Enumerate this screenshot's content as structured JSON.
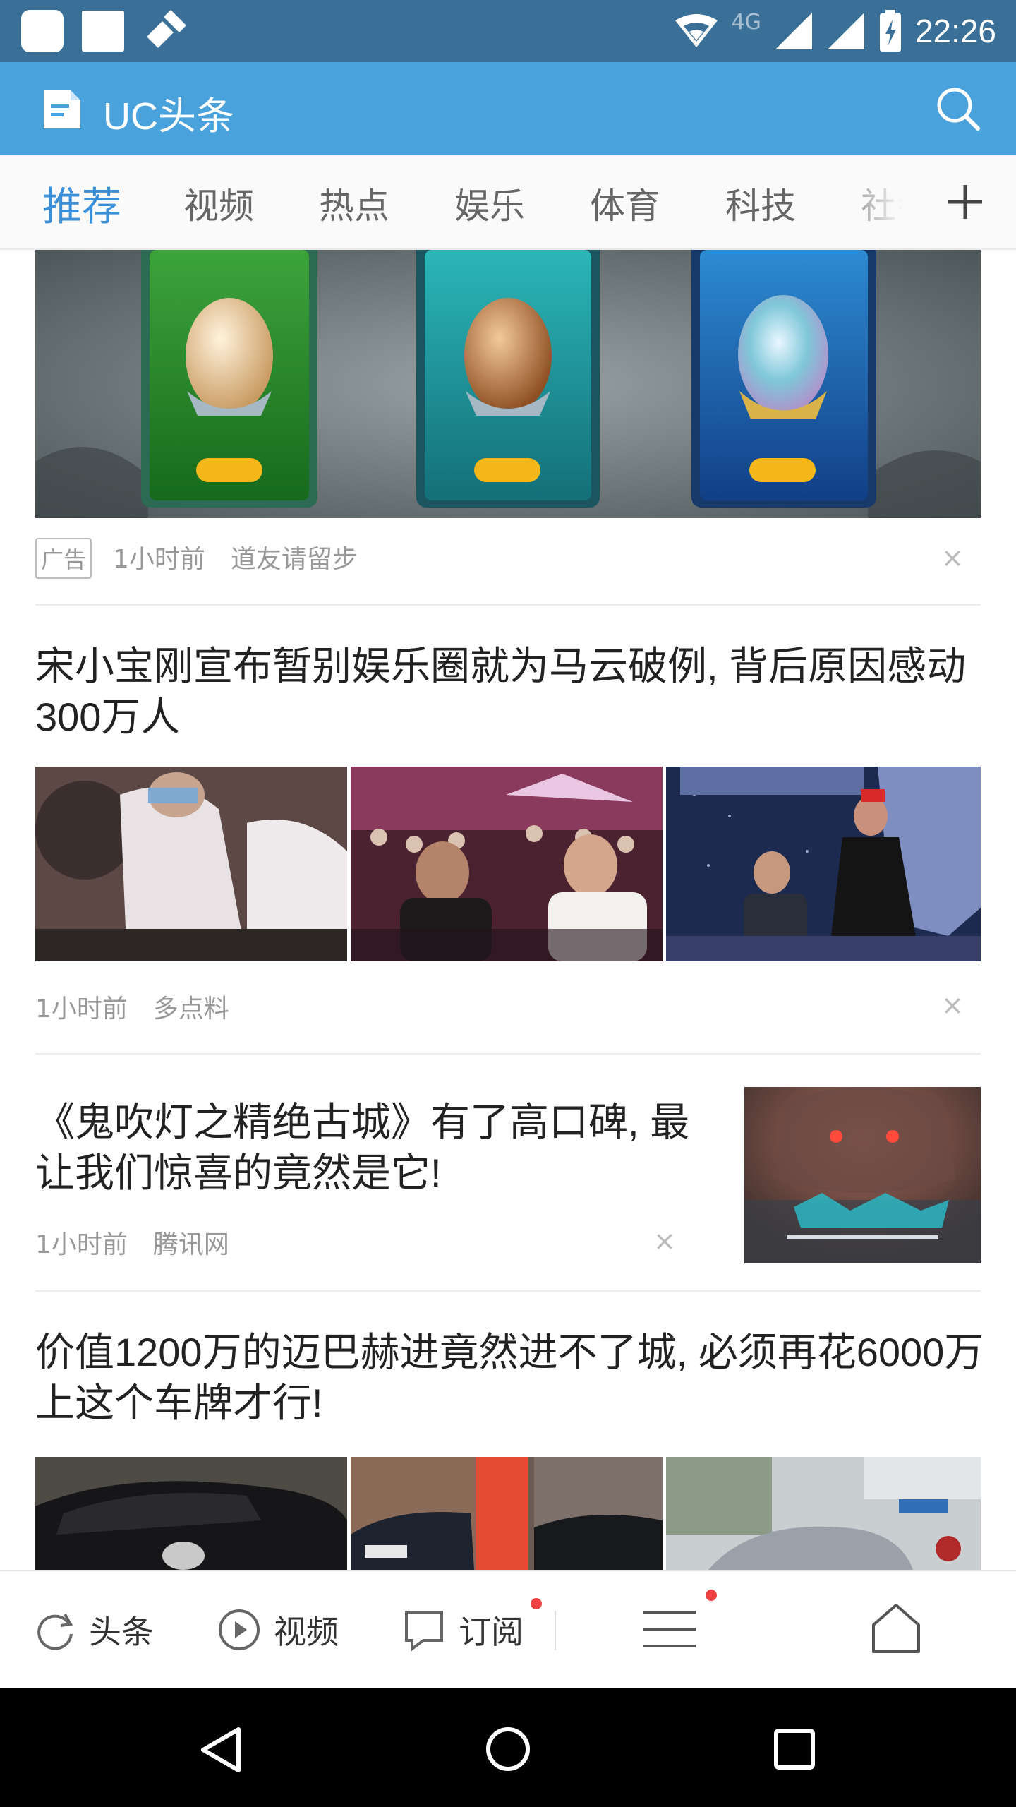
{
  "status_bar": {
    "network": "4G",
    "time": "22:26"
  },
  "app_bar": {
    "title": "UC头条"
  },
  "tabs": [
    {
      "label": "推荐",
      "active": true
    },
    {
      "label": "视频"
    },
    {
      "label": "热点"
    },
    {
      "label": "娱乐"
    },
    {
      "label": "体育"
    },
    {
      "label": "科技"
    },
    {
      "label": "社会"
    }
  ],
  "feed": {
    "ad": {
      "tag": "广告",
      "time": "1小时前",
      "source": "道友请留步"
    },
    "article1": {
      "title": "宋小宝刚宣布暂别娱乐圈就为马云破例, 背后原因感动300万人",
      "time": "1小时前",
      "source": "多点料"
    },
    "article2": {
      "title": "《鬼吹灯之精绝古城》有了高口碑, 最让我们惊喜的竟然是它!",
      "time": "1小时前",
      "source": "腾讯网"
    },
    "article3": {
      "title": "价值1200万的迈巴赫进竟然进不了城, 必须再花6000万上这个车牌才行!"
    }
  },
  "bottom_nav": {
    "headlines": "头条",
    "video": "视频",
    "subscribe": "订阅"
  },
  "colors": {
    "status_bar": "#3a6f98",
    "app_bar": "#4aa2dd",
    "tab_active": "#3a8fd8",
    "badge_dot": "#f04141"
  }
}
